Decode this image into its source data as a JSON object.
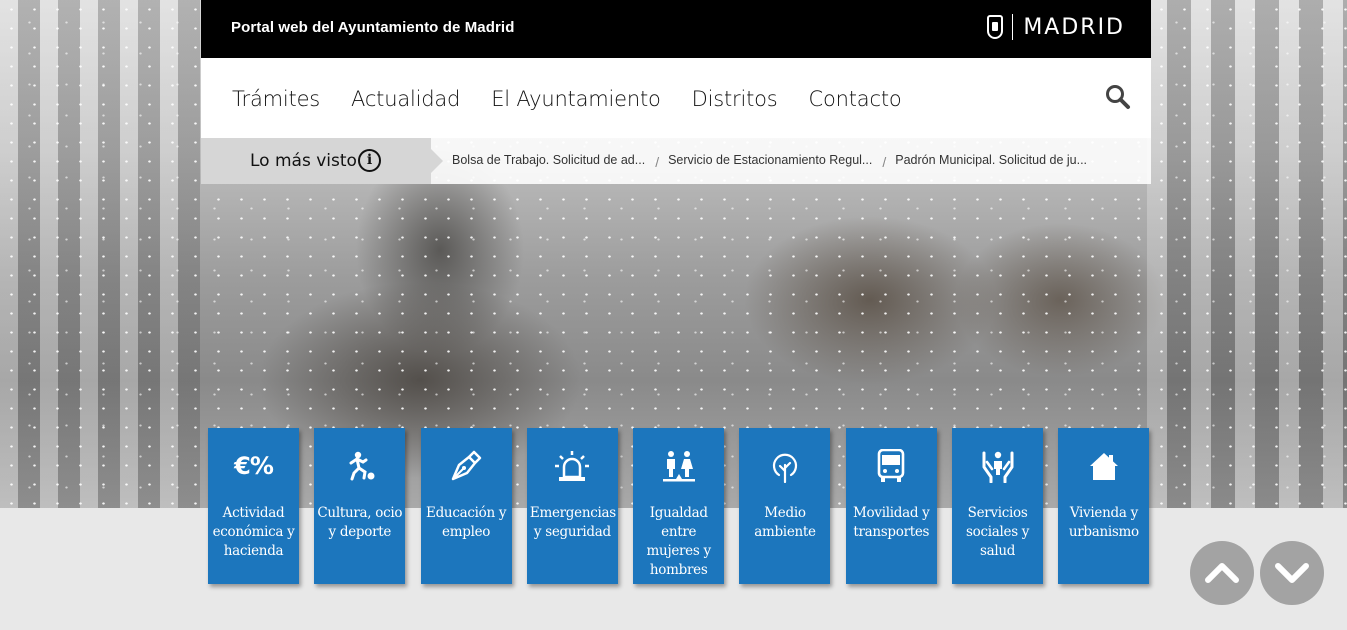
{
  "header": {
    "portal_title": "Portal web del Ayuntamiento de Madrid",
    "logo_text": "MADRID"
  },
  "nav": {
    "items": [
      "Trámites",
      "Actualidad",
      "El Ayuntamiento",
      "Distritos",
      "Contacto"
    ],
    "search_icon": "search-icon"
  },
  "most_viewed": {
    "label": "Lo más visto",
    "info_icon": "i",
    "links": [
      "Bolsa de Trabajo. Solicitud de ad...",
      "Servicio de Estacionamiento Regul...",
      "Padrón Municipal. Solicitud de ju..."
    ],
    "separator": "/"
  },
  "tiles": [
    {
      "label": "Actividad económica y hacienda",
      "icon": "euro-percent-icon",
      "icon_text": "€%"
    },
    {
      "label": "Cultura, ocio y deporte",
      "icon": "runner-ball-icon"
    },
    {
      "label": "Educación y empleo",
      "icon": "pen-nib-icon"
    },
    {
      "label": "Emergencias y seguridad",
      "icon": "siren-icon"
    },
    {
      "label": "Igualdad entre mujeres y hombres",
      "icon": "equality-scale-icon"
    },
    {
      "label": "Medio ambiente",
      "icon": "tree-icon"
    },
    {
      "label": "Movilidad y transportes",
      "icon": "bus-icon"
    },
    {
      "label": "Servicios sociales y salud",
      "icon": "care-hands-icon"
    },
    {
      "label": "Vivienda y urbanismo",
      "icon": "house-icon"
    }
  ],
  "colors": {
    "tile_blue": "#1c76bd",
    "header_black": "#000000",
    "scroll_button_gray": "#a3a3a3"
  }
}
